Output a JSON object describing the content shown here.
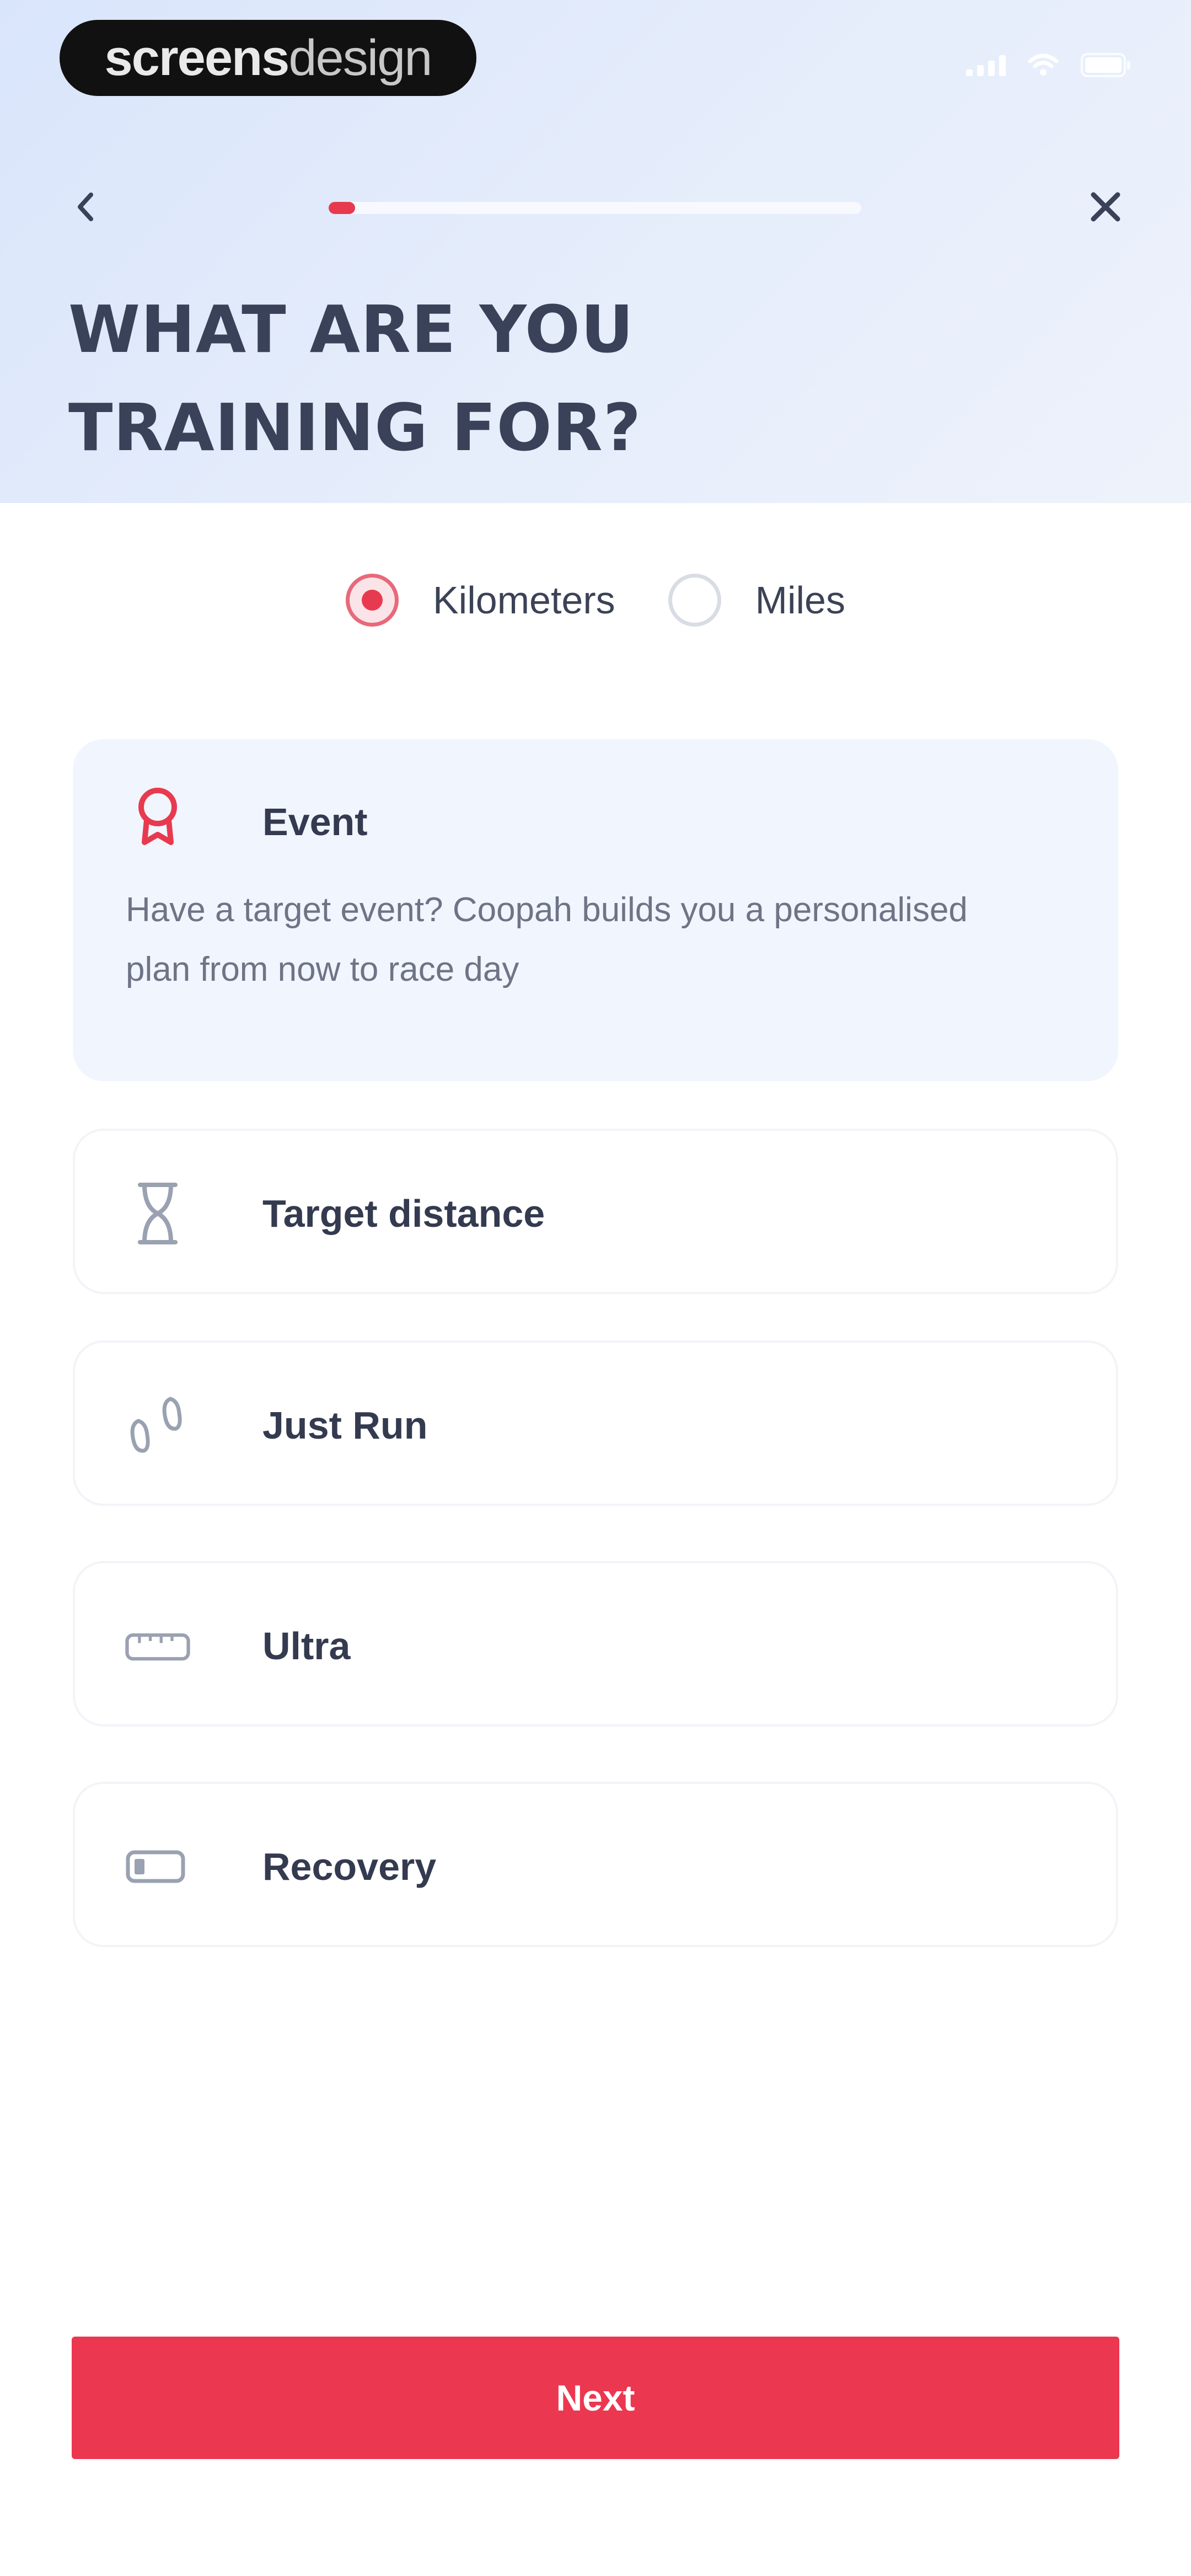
{
  "status_bar": {
    "brand_bold": "screens",
    "brand_light": "design"
  },
  "nav": {
    "progress": 0.05
  },
  "page_title": "WHAT ARE YOU TRAINING FOR?",
  "units": {
    "options": [
      {
        "label": "Kilometers",
        "selected": true
      },
      {
        "label": "Miles",
        "selected": false
      }
    ]
  },
  "options": [
    {
      "icon": "award-ribbon-icon",
      "title": "Event",
      "description": "Have a target event? Coopah builds you a personalised plan from now to race day",
      "selected": true
    },
    {
      "icon": "hourglass-icon",
      "title": "Target distance",
      "selected": false
    },
    {
      "icon": "footprints-icon",
      "title": "Just Run",
      "selected": false
    },
    {
      "icon": "ruler-icon",
      "title": "Ultra",
      "selected": false
    },
    {
      "icon": "battery-low-icon",
      "title": "Recovery",
      "selected": false
    }
  ],
  "next_label": "Next",
  "colors": {
    "accent": "#ec3750",
    "header_bg": "#dfe8fb",
    "selected_card_bg": "#f1f5fd",
    "title_text": "#3a4259"
  }
}
